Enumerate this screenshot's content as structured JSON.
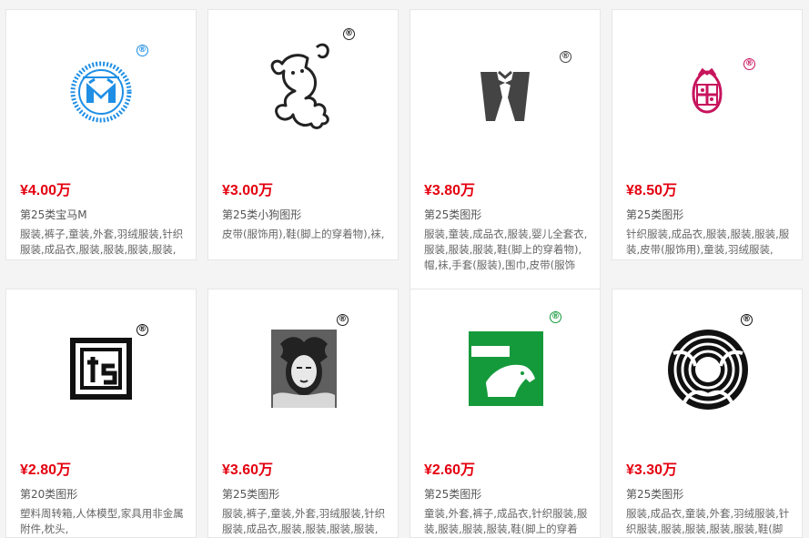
{
  "colors": {
    "price": "#e4000f",
    "brand_blue": "#1f8fe6",
    "brand_pink": "#c7145d",
    "brand_green": "#159a3b"
  },
  "cards": [
    {
      "price": "¥4.00万",
      "name": "第25类宝马M",
      "desc": "服装,裤子,童装,外套,羽绒服装,针织服装,成品衣,服装,服装,服装,服装,鞋(脚",
      "logo_icon": "circular-blue-m-logo-icon"
    },
    {
      "price": "¥3.00万",
      "name": "第25类小狗图形",
      "desc": "皮带(服饰用),鞋(脚上的穿着物),袜,",
      "logo_icon": "puppy-outline-logo-icon"
    },
    {
      "price": "¥3.80万",
      "name": "第25类图形",
      "desc": "服装,童装,成品衣,服装,婴儿全套衣,服装,服装,服装,鞋(脚上的穿着物),帽,袜,手套(服装),围巾,皮带(服饰用),",
      "logo_icon": "tuxedo-bowtie-logo-icon"
    },
    {
      "price": "¥8.50万",
      "name": "第25类图形",
      "desc": "针织服装,成品衣,服装,服装,服装,服装,皮带(服饰用),童装,羽绒服装,",
      "logo_icon": "pink-crest-logo-icon"
    },
    {
      "price": "¥2.80万",
      "name": "第20类图形",
      "desc": "塑料周转箱,人体模型,家具用非金属附件,枕头,",
      "logo_icon": "tg-square-logo-icon"
    },
    {
      "price": "¥3.60万",
      "name": "第25类图形",
      "desc": "服装,裤子,童装,外套,羽绒服装,针织服装,成品衣,服装,服装,服装,服装,鞋(脚",
      "logo_icon": "vintage-portrait-logo-icon"
    },
    {
      "price": "¥2.60万",
      "name": "第25类图形",
      "desc": "童装,外套,裤子,成品衣,针织服装,服装,服装,服装,服装,鞋(脚上的穿着物),",
      "logo_icon": "green-horse-head-logo-icon"
    },
    {
      "price": "¥3.30万",
      "name": "第25类图形",
      "desc": "服装,成品衣,童装,外套,羽绒服装,针织服装,服装,服装,服装,服装,鞋(脚上的",
      "logo_icon": "swirl-circle-logo-icon"
    }
  ],
  "reg_mark": "®"
}
